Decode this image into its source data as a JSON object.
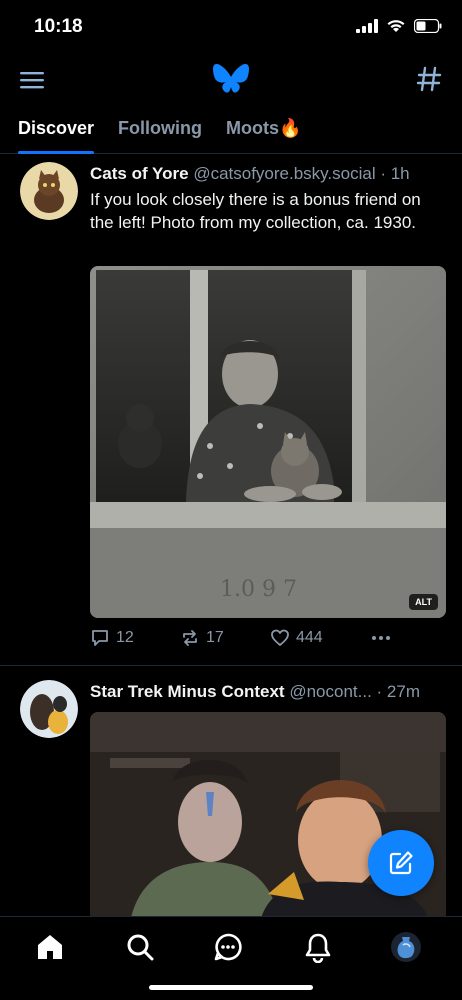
{
  "status_bar": {
    "time": "10:18",
    "icons": [
      "signal-icon",
      "wifi-icon",
      "battery-icon"
    ]
  },
  "header": {
    "menu_icon": "hamburger-menu-icon",
    "logo": "butterfly-logo",
    "feeds_icon": "hashtag-icon"
  },
  "tabs": [
    {
      "label": "Discover",
      "active": true
    },
    {
      "label": "Following",
      "active": false
    },
    {
      "label": "Moots🔥",
      "active": false
    }
  ],
  "posts": [
    {
      "author": "Cats of Yore",
      "handle": "@catsofyore.bsky.social",
      "time": "· 1h",
      "text": "If you look closely there is a bonus friend on the left! Photo from my collection, ca. 1930.",
      "image_alt_badge": "ALT",
      "reply_count": "12",
      "repost_count": "17",
      "like_count": "444"
    },
    {
      "author": "Star Trek Minus Context",
      "handle": "@nocont...",
      "time": "· 27m"
    }
  ],
  "bottom_nav": [
    "home-icon",
    "search-icon",
    "chat-icon",
    "bell-icon",
    "profile-avatar"
  ],
  "colors": {
    "background": "#000000",
    "accent": "#1083fe",
    "muted_text": "#8a98a8",
    "divider": "#1e2936"
  }
}
